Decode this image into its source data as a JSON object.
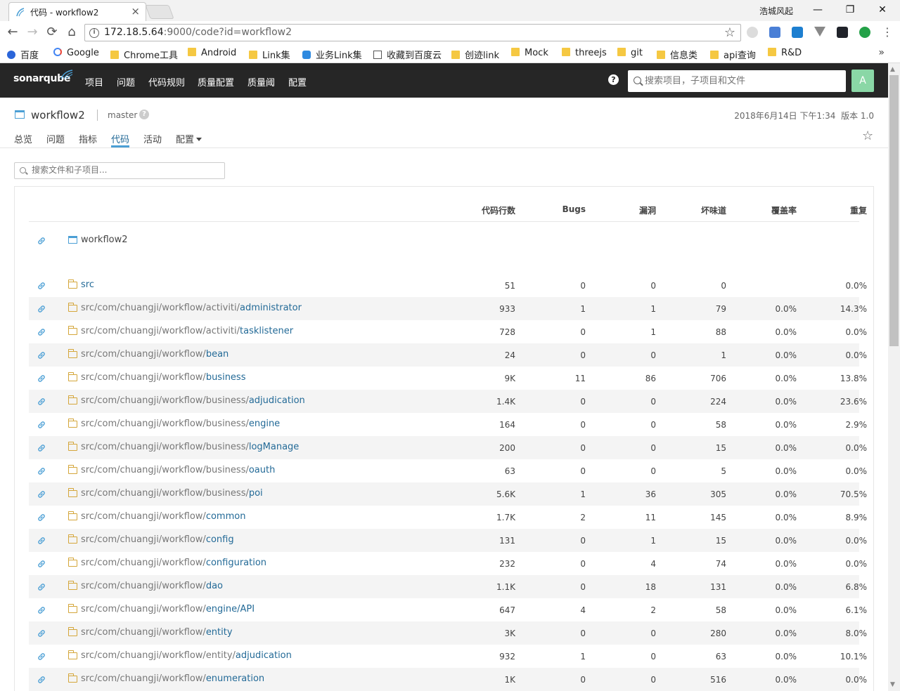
{
  "browser": {
    "tab_title": "代码 - workflow2",
    "tab_close": "×",
    "window_user": "浩城风起",
    "win_min": "—",
    "win_max": "❐",
    "win_close": "✕",
    "back": "←",
    "forward": "→",
    "reload": "⟳",
    "home": "⌂",
    "url_host": "172.18.5.64",
    "url_rest": ":9000/code?id=workflow2",
    "star": "☆",
    "bookmarks": [
      {
        "label": "百度",
        "icon": "baidu-icon"
      },
      {
        "label": "Google",
        "icon": "google-icon"
      },
      {
        "label": "Chrome工具",
        "icon": "folder-icon"
      },
      {
        "label": "Android",
        "icon": "folder-icon"
      },
      {
        "label": "Link集",
        "icon": "folder-icon"
      },
      {
        "label": "业务Link集",
        "icon": "cloud-icon"
      },
      {
        "label": "收藏到百度云",
        "icon": "page-icon"
      },
      {
        "label": "创迹link",
        "icon": "folder-icon"
      },
      {
        "label": "Mock",
        "icon": "folder-icon"
      },
      {
        "label": "threejs",
        "icon": "folder-icon"
      },
      {
        "label": "git",
        "icon": "folder-icon"
      },
      {
        "label": "信息类",
        "icon": "folder-icon"
      },
      {
        "label": "api查询",
        "icon": "folder-icon"
      },
      {
        "label": "R&D",
        "icon": "folder-icon"
      }
    ],
    "bookmarks_more": "»",
    "colors": {
      "folder": "#f5c842"
    }
  },
  "navbar": {
    "logo_text": "sonarqube",
    "menu": [
      "项目",
      "问题",
      "代码规则",
      "质量配置",
      "质量阈",
      "配置"
    ],
    "help": "?",
    "search_placeholder": "搜索项目，子项目和文件",
    "avatar_letter": "A",
    "colors": {
      "background": "#262626",
      "avatar": "#8ad7a6"
    }
  },
  "component": {
    "name": "workflow2",
    "branch": "master",
    "branch_help": "?",
    "date": "2018年6月14日 下午1:34",
    "version": "版本 1.0",
    "favorite": "☆",
    "tabs": [
      "总览",
      "问题",
      "指标",
      "代码",
      "活动",
      "配置"
    ],
    "active_tab": "代码"
  },
  "code": {
    "filter_placeholder": "搜索文件和子项目...",
    "columns": [
      "代码行数",
      "Bugs",
      "漏洞",
      "坏味道",
      "覆盖率",
      "重复"
    ],
    "root": "workflow2",
    "rows": [
      {
        "prefix": "",
        "suffix": "src",
        "loc": "51",
        "bugs": "0",
        "vulns": "0",
        "smells": "0",
        "coverage": "",
        "dup": "0.0%"
      },
      {
        "prefix": "src/com/chuangji/workflow/activiti/",
        "suffix": "administrator",
        "loc": "933",
        "bugs": "1",
        "vulns": "1",
        "smells": "79",
        "coverage": "0.0%",
        "dup": "14.3%"
      },
      {
        "prefix": "src/com/chuangji/workflow/activiti/",
        "suffix": "tasklistener",
        "loc": "728",
        "bugs": "0",
        "vulns": "1",
        "smells": "88",
        "coverage": "0.0%",
        "dup": "0.0%"
      },
      {
        "prefix": "src/com/chuangji/workflow/",
        "suffix": "bean",
        "loc": "24",
        "bugs": "0",
        "vulns": "0",
        "smells": "1",
        "coverage": "0.0%",
        "dup": "0.0%"
      },
      {
        "prefix": "src/com/chuangji/workflow/",
        "suffix": "business",
        "loc": "9K",
        "bugs": "11",
        "vulns": "86",
        "smells": "706",
        "coverage": "0.0%",
        "dup": "13.8%"
      },
      {
        "prefix": "src/com/chuangji/workflow/business/",
        "suffix": "adjudication",
        "loc": "1.4K",
        "bugs": "0",
        "vulns": "0",
        "smells": "224",
        "coverage": "0.0%",
        "dup": "23.6%"
      },
      {
        "prefix": "src/com/chuangji/workflow/business/",
        "suffix": "engine",
        "loc": "164",
        "bugs": "0",
        "vulns": "0",
        "smells": "58",
        "coverage": "0.0%",
        "dup": "2.9%"
      },
      {
        "prefix": "src/com/chuangji/workflow/business/",
        "suffix": "logManage",
        "loc": "200",
        "bugs": "0",
        "vulns": "0",
        "smells": "15",
        "coverage": "0.0%",
        "dup": "0.0%"
      },
      {
        "prefix": "src/com/chuangji/workflow/business/",
        "suffix": "oauth",
        "loc": "63",
        "bugs": "0",
        "vulns": "0",
        "smells": "5",
        "coverage": "0.0%",
        "dup": "0.0%"
      },
      {
        "prefix": "src/com/chuangji/workflow/business/",
        "suffix": "poi",
        "loc": "5.6K",
        "bugs": "1",
        "vulns": "36",
        "smells": "305",
        "coverage": "0.0%",
        "dup": "70.5%"
      },
      {
        "prefix": "src/com/chuangji/workflow/",
        "suffix": "common",
        "loc": "1.7K",
        "bugs": "2",
        "vulns": "11",
        "smells": "145",
        "coverage": "0.0%",
        "dup": "8.9%"
      },
      {
        "prefix": "src/com/chuangji/workflow/",
        "suffix": "config",
        "loc": "131",
        "bugs": "0",
        "vulns": "1",
        "smells": "15",
        "coverage": "0.0%",
        "dup": "0.0%"
      },
      {
        "prefix": "src/com/chuangji/workflow/",
        "suffix": "configuration",
        "loc": "232",
        "bugs": "0",
        "vulns": "4",
        "smells": "74",
        "coverage": "0.0%",
        "dup": "0.0%"
      },
      {
        "prefix": "src/com/chuangji/workflow/",
        "suffix": "dao",
        "loc": "1.1K",
        "bugs": "0",
        "vulns": "18",
        "smells": "131",
        "coverage": "0.0%",
        "dup": "6.8%"
      },
      {
        "prefix": "src/com/chuangji/workflow/",
        "suffix": "engine/API",
        "loc": "647",
        "bugs": "4",
        "vulns": "2",
        "smells": "58",
        "coverage": "0.0%",
        "dup": "6.1%"
      },
      {
        "prefix": "src/com/chuangji/workflow/",
        "suffix": "entity",
        "loc": "3K",
        "bugs": "0",
        "vulns": "0",
        "smells": "280",
        "coverage": "0.0%",
        "dup": "8.0%"
      },
      {
        "prefix": "src/com/chuangji/workflow/entity/",
        "suffix": "adjudication",
        "loc": "932",
        "bugs": "1",
        "vulns": "0",
        "smells": "63",
        "coverage": "0.0%",
        "dup": "10.1%"
      },
      {
        "prefix": "src/com/chuangji/workflow/",
        "suffix": "enumeration",
        "loc": "1K",
        "bugs": "0",
        "vulns": "0",
        "smells": "516",
        "coverage": "0.0%",
        "dup": "0.0%"
      }
    ]
  }
}
